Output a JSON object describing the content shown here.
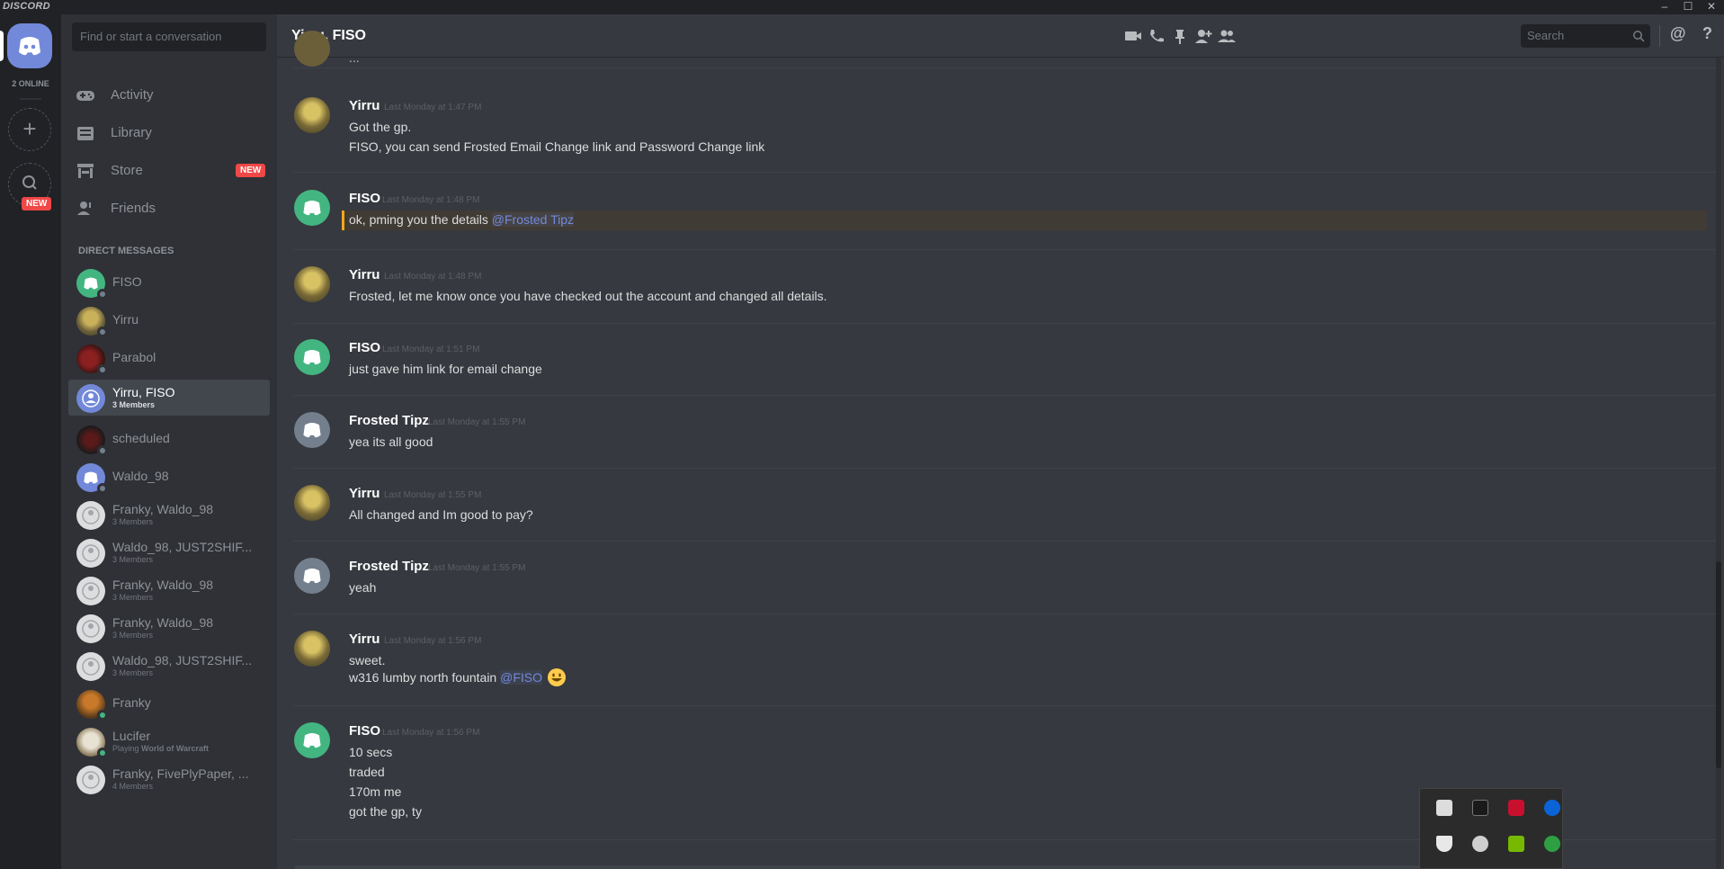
{
  "app": {
    "brand": "DISCORD"
  },
  "window": {
    "minimize": "–",
    "maximize": "☐",
    "close": "✕"
  },
  "guilds": {
    "online_count": "2 ONLINE",
    "add_symbol": "+",
    "new_badge": "NEW"
  },
  "sidebar": {
    "search_placeholder": "Find or start a conversation",
    "nav": [
      {
        "label": "Activity",
        "icon": "gamepad-icon"
      },
      {
        "label": "Library",
        "icon": "library-icon"
      },
      {
        "label": "Store",
        "icon": "store-icon",
        "badge": "NEW"
      },
      {
        "label": "Friends",
        "icon": "friends-icon"
      }
    ],
    "dm_header": "DIRECT MESSAGES",
    "dms": [
      {
        "name": "FISO",
        "sub": "",
        "status": "offline"
      },
      {
        "name": "Yirru",
        "sub": "",
        "status": "offline"
      },
      {
        "name": "Parabol",
        "sub": "",
        "status": "offline"
      },
      {
        "name": "Yirru, FISO",
        "sub": "3 Members",
        "status": ""
      },
      {
        "name": "scheduled",
        "sub": "",
        "status": "offline"
      },
      {
        "name": "Waldo_98",
        "sub": "",
        "status": "offline"
      },
      {
        "name": "Franky, Waldo_98",
        "sub": "3 Members",
        "status": ""
      },
      {
        "name": "Waldo_98, JUST2SHIF...",
        "sub": "3 Members",
        "status": ""
      },
      {
        "name": "Franky, Waldo_98",
        "sub": "3 Members",
        "status": ""
      },
      {
        "name": "Franky, Waldo_98",
        "sub": "3 Members",
        "status": ""
      },
      {
        "name": "Waldo_98, JUST2SHIF...",
        "sub": "3 Members",
        "status": ""
      },
      {
        "name": "Franky",
        "sub": "",
        "status": "online"
      },
      {
        "name": "Lucifer",
        "sub_prefix": "Playing ",
        "sub_bold": "World of Warcraft",
        "status": "online"
      },
      {
        "name": "Franky, FivePlyPaper, ...",
        "sub": "4 Members",
        "status": ""
      }
    ]
  },
  "header": {
    "title": "Yirru, FISO",
    "search_placeholder": "Search",
    "icons": [
      "video-call-icon",
      "phone-call-icon",
      "pin-icon",
      "add-member-icon",
      "members-icon",
      "mention-icon",
      "help-icon"
    ],
    "mention_symbol": "@",
    "help_symbol": "?"
  },
  "messages": [
    {
      "author": "Yirru",
      "time": "Last Monday at 1:47 PM",
      "avatar": "yirru",
      "lines": [
        "Got the gp.",
        "FISO, you can send Frosted Email Change link and Password Change link"
      ]
    },
    {
      "author": "FISO",
      "time": "Last Monday at 1:48 PM",
      "avatar": "discord-green",
      "lines": [
        "ok, pming you the details "
      ],
      "mention": "@Frosted Tipz",
      "highlighted": true
    },
    {
      "author": "Yirru",
      "time": "Last Monday at 1:48 PM",
      "avatar": "yirru",
      "lines": [
        "Frosted, let me know once you have checked out the account and changed all details."
      ]
    },
    {
      "author": "FISO",
      "time": "Last Monday at 1:51 PM",
      "avatar": "discord-green",
      "lines": [
        "just gave him link for email change"
      ]
    },
    {
      "author": "Frosted Tipz",
      "time": "Last Monday at 1:55 PM",
      "avatar": "discord-grey",
      "lines": [
        "yea its all good"
      ]
    },
    {
      "author": "Yirru",
      "time": "Last Monday at 1:55 PM",
      "avatar": "yirru",
      "lines": [
        "All changed and Im good to pay?"
      ]
    },
    {
      "author": "Frosted Tipz",
      "time": "Last Monday at 1:55 PM",
      "avatar": "discord-grey",
      "lines": [
        "yeah"
      ]
    },
    {
      "author": "Yirru",
      "time": "Last Monday at 1:56 PM",
      "avatar": "yirru",
      "lines": [
        "sweet.",
        "w316 lumby north fountain "
      ],
      "mention": "@FISO",
      "emoji": "smiley-emoji"
    },
    {
      "author": "FISO",
      "time": "Last Monday at 1:56 PM",
      "avatar": "discord-green",
      "lines": [
        "10 secs",
        "traded",
        "170m me",
        "got the gp, ty"
      ]
    }
  ],
  "colors": {
    "blurple": "#7289da",
    "green_avatar": "#43b581",
    "grey_avatar": "#747f8d",
    "highlight_bar": "#faa61a",
    "badge_red": "#f04747"
  },
  "tray": {
    "icons": [
      "screenshot-icon",
      "audio-icon",
      "antivirus-icon",
      "bluetooth-icon",
      "security-shield-icon",
      "network-icon",
      "nvidia-icon",
      "update-icon"
    ]
  }
}
